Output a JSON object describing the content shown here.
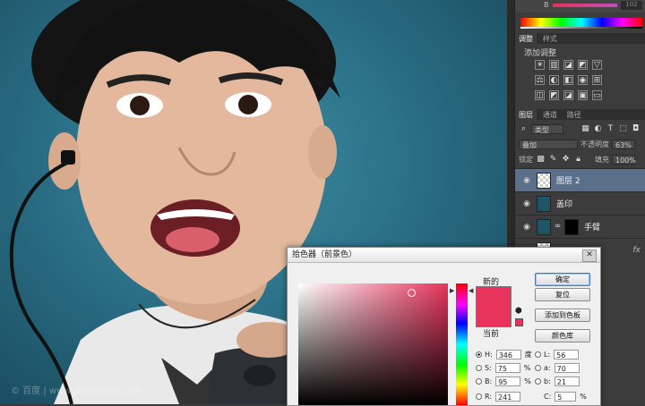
{
  "panel": {
    "color_top": {
      "channel": "B",
      "value": "102"
    },
    "adjust_tabs": [
      "调整",
      "样式"
    ],
    "adjust_title": "添加调整",
    "adjust_rows": [
      [
        "☀",
        "▥",
        "◪",
        "◩",
        "▽"
      ],
      [
        "⚖",
        "◐",
        "◧",
        "◉",
        "⊞"
      ],
      [
        "◫",
        "◩",
        "◪",
        "▣",
        "▭"
      ]
    ],
    "layers_tabs": [
      "图层",
      "通道",
      "路径"
    ],
    "filter_kind": "类型",
    "blend_mode": "叠加",
    "opacity_label": "不透明度",
    "opacity_value": "63%",
    "lock_label": "锁定",
    "fill_label": "填充",
    "fill_value": "100%",
    "layers": [
      {
        "name": "图层 2"
      },
      {
        "name": "盖印"
      },
      {
        "name": "手臂"
      },
      {
        "name": "",
        "fx": "fx"
      }
    ]
  },
  "dialog": {
    "title": "拾色器（前景色）",
    "new_label": "新的",
    "current_label": "当前",
    "buttons": {
      "ok": "确定",
      "reset": "复位",
      "add_swatch": "添加到色板",
      "color_libraries": "颜色库"
    },
    "fields": [
      {
        "label": "H:",
        "value": "346",
        "unit": "度",
        "checked": true
      },
      {
        "label": "S:",
        "value": "75",
        "unit": "%",
        "checked": false
      },
      {
        "label": "B:",
        "value": "95",
        "unit": "%",
        "checked": false
      },
      {
        "label": "R:",
        "value": "241",
        "unit": "",
        "checked": false
      }
    ],
    "lab_fields": [
      {
        "label": "L:",
        "value": "56"
      },
      {
        "label": "a:",
        "value": "70"
      },
      {
        "label": "b:",
        "value": "21"
      },
      {
        "label": "C:",
        "value": "5",
        "unit": "%"
      }
    ],
    "selected_color": "#e8335c"
  },
  "watermark": "© 百度 | www.photoshop.com"
}
